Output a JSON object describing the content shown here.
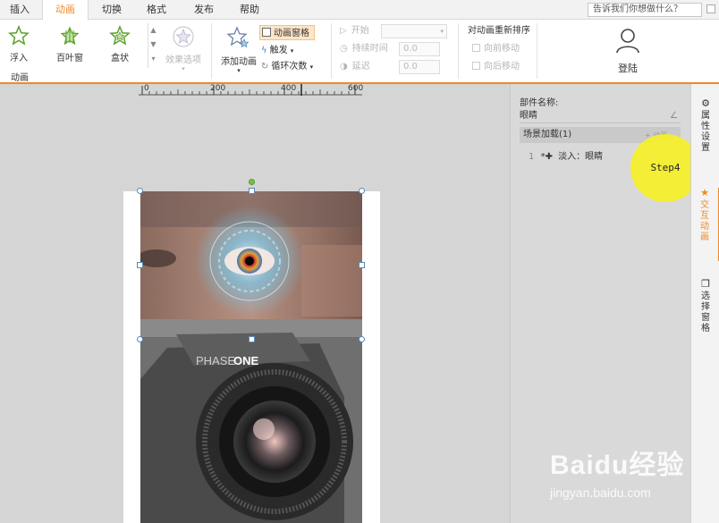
{
  "menu": {
    "items": [
      "插入",
      "动画",
      "切换",
      "格式",
      "发布",
      "帮助"
    ],
    "active_index": 1,
    "help_search_placeholder": "告诉我们你想做什么？"
  },
  "ribbon": {
    "effects": [
      {
        "label": "浮入",
        "icon": "star-float-icon"
      },
      {
        "label": "百叶窗",
        "icon": "blinds-icon"
      },
      {
        "label": "盒状",
        "icon": "box-star-icon"
      }
    ],
    "effect_options_label": "效果选项",
    "group_caption": "动画",
    "add_animation_label": "添加动画",
    "animation_pane_label": "动画窗格",
    "trigger_label": "触发",
    "loop_label": "循环次数",
    "start_label": "开始",
    "duration_label": "持续时间",
    "delay_label": "延迟",
    "duration_value": "0.0",
    "delay_value": "0.0",
    "reorder_title": "对动画重新排序",
    "move_earlier_label": "向前移动",
    "move_later_label": "向后移动",
    "login_label": "登陆"
  },
  "ruler": {
    "ticks": [
      "0",
      "200",
      "400",
      "600"
    ]
  },
  "panel": {
    "component_name_label": "部件名称:",
    "component_name_value": "眼睛",
    "scene_label": "场景加载(1)",
    "add_animation_link": "+ 动画",
    "item_number": "1",
    "item_text": "淡入：眼睛"
  },
  "step_marker": "Step4",
  "side_tabs": [
    {
      "label": "属性设置",
      "icon": "gear-icon"
    },
    {
      "label": "交互动画",
      "icon": "star-icon"
    },
    {
      "label": "选择窗格",
      "icon": "layers-icon"
    }
  ],
  "watermark": {
    "logo": "Baidu经验",
    "url": "jingyan.baidu.com"
  },
  "colors": {
    "accent": "#f08a24",
    "step": "#f6f028"
  }
}
